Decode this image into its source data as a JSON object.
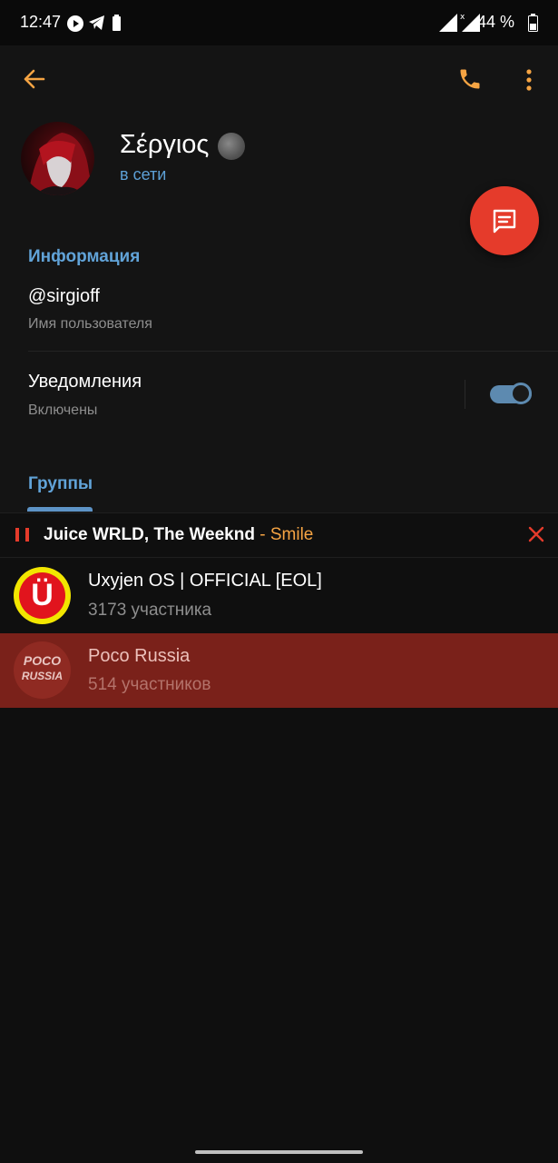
{
  "status_bar": {
    "time": "12:47",
    "battery": "44 %"
  },
  "profile": {
    "name": "Σέργιος",
    "status": "в сети"
  },
  "info": {
    "section_title": "Информация",
    "username": "@sirgioff",
    "username_label": "Имя пользователя",
    "notifications_label": "Уведомления",
    "notifications_value": "Включены",
    "notifications_on": true
  },
  "groups_tab": {
    "label": "Группы"
  },
  "player": {
    "artist": "Juice WRLD, The Weeknd",
    "separator": " - ",
    "song": "Smile"
  },
  "groups": [
    {
      "name": "Uxyjen OS | OFFICIAL [EOL]",
      "members": "3173 участника",
      "avatar_letter": "Ü"
    },
    {
      "name": "Poco Russia",
      "members": "514 участников",
      "avatar_line1": "POCO",
      "avatar_line2": "RUSSIA"
    }
  ],
  "colors": {
    "accent_blue": "#61a3d8",
    "accent_orange": "#f5a443",
    "fab_red": "#e53b2b",
    "highlight_row": "#7a211a"
  }
}
